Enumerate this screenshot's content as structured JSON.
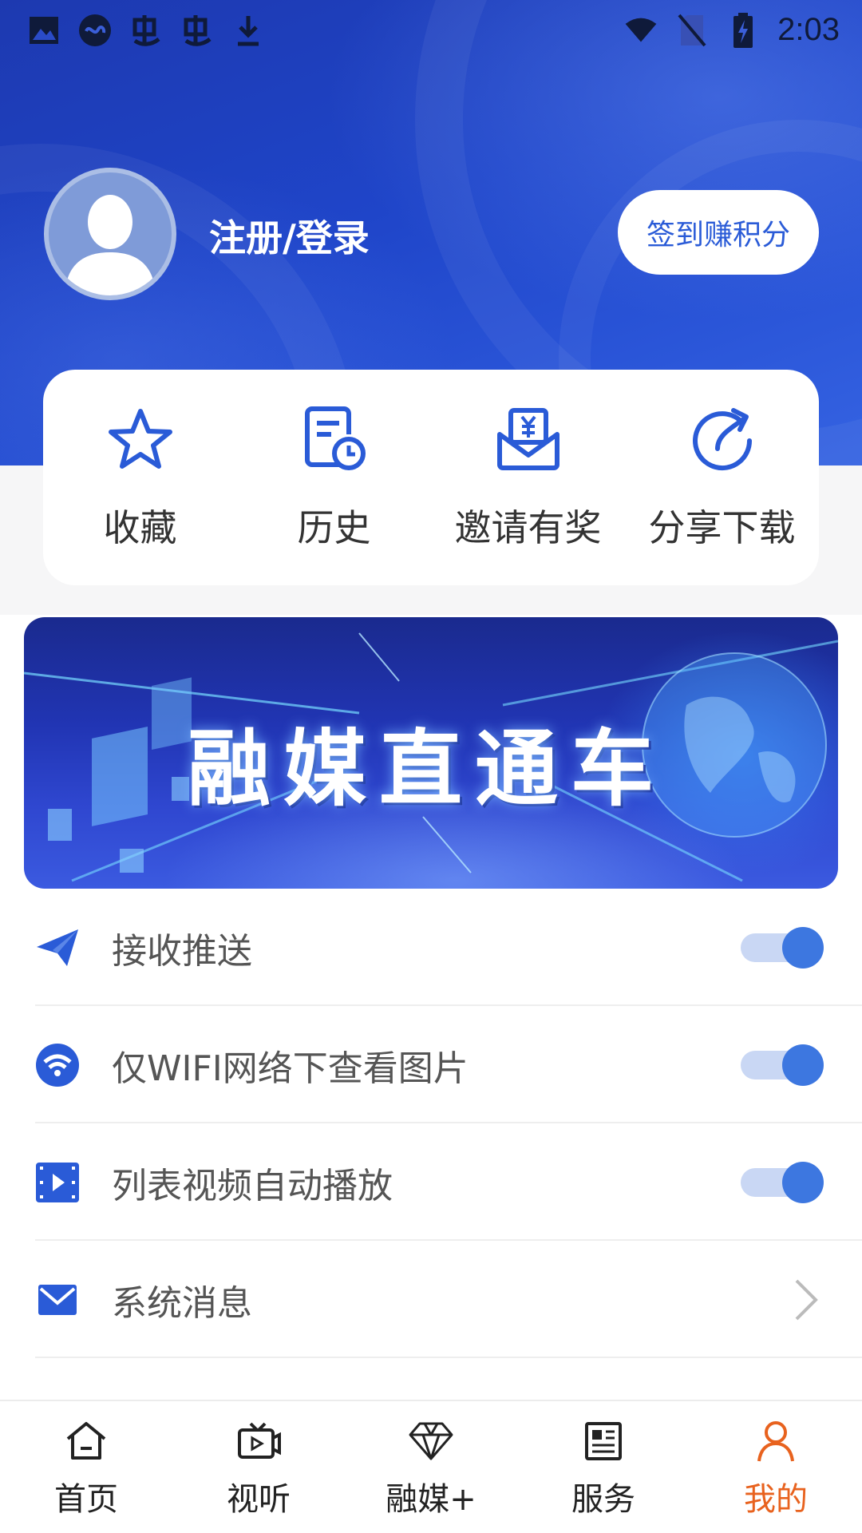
{
  "status_bar": {
    "time": "2:03",
    "left_icons": [
      "image-icon",
      "app-icon",
      "bug-icon",
      "bug-icon",
      "download-icon"
    ],
    "right_icons": [
      "wifi-icon",
      "no-sim-icon",
      "battery-charging-icon"
    ]
  },
  "profile": {
    "login_label": "注册/登录",
    "checkin_label": "签到赚积分"
  },
  "quick_actions": [
    {
      "label": "收藏",
      "icon": "star-icon"
    },
    {
      "label": "历史",
      "icon": "history-icon"
    },
    {
      "label": "邀请有奖",
      "icon": "invite-reward-icon"
    },
    {
      "label": "分享下载",
      "icon": "share-icon"
    }
  ],
  "banner": {
    "title": "融媒直通车"
  },
  "settings": [
    {
      "label": "接收推送",
      "icon": "send-icon",
      "control": "toggle",
      "on": true
    },
    {
      "label": "仅WIFI网络下查看图片",
      "icon": "wifi-circle-icon",
      "control": "toggle",
      "on": true
    },
    {
      "label": "列表视频自动播放",
      "icon": "video-icon",
      "control": "toggle",
      "on": true
    },
    {
      "label": "系统消息",
      "icon": "mail-icon",
      "control": "chevron"
    }
  ],
  "tabs": [
    {
      "label": "首页",
      "icon": "home-icon",
      "active": false
    },
    {
      "label": "视听",
      "icon": "tv-icon",
      "active": false
    },
    {
      "label": "融媒+",
      "icon": "diamond-icon",
      "active": false
    },
    {
      "label": "服务",
      "icon": "newspaper-icon",
      "active": false
    },
    {
      "label": "我的",
      "icon": "user-icon",
      "active": true
    }
  ],
  "colors": {
    "header_blue": "#1f45c9",
    "accent_blue": "#2a5bd7",
    "toggle_on": "#3d77e0",
    "active_tab": "#e8621e"
  }
}
